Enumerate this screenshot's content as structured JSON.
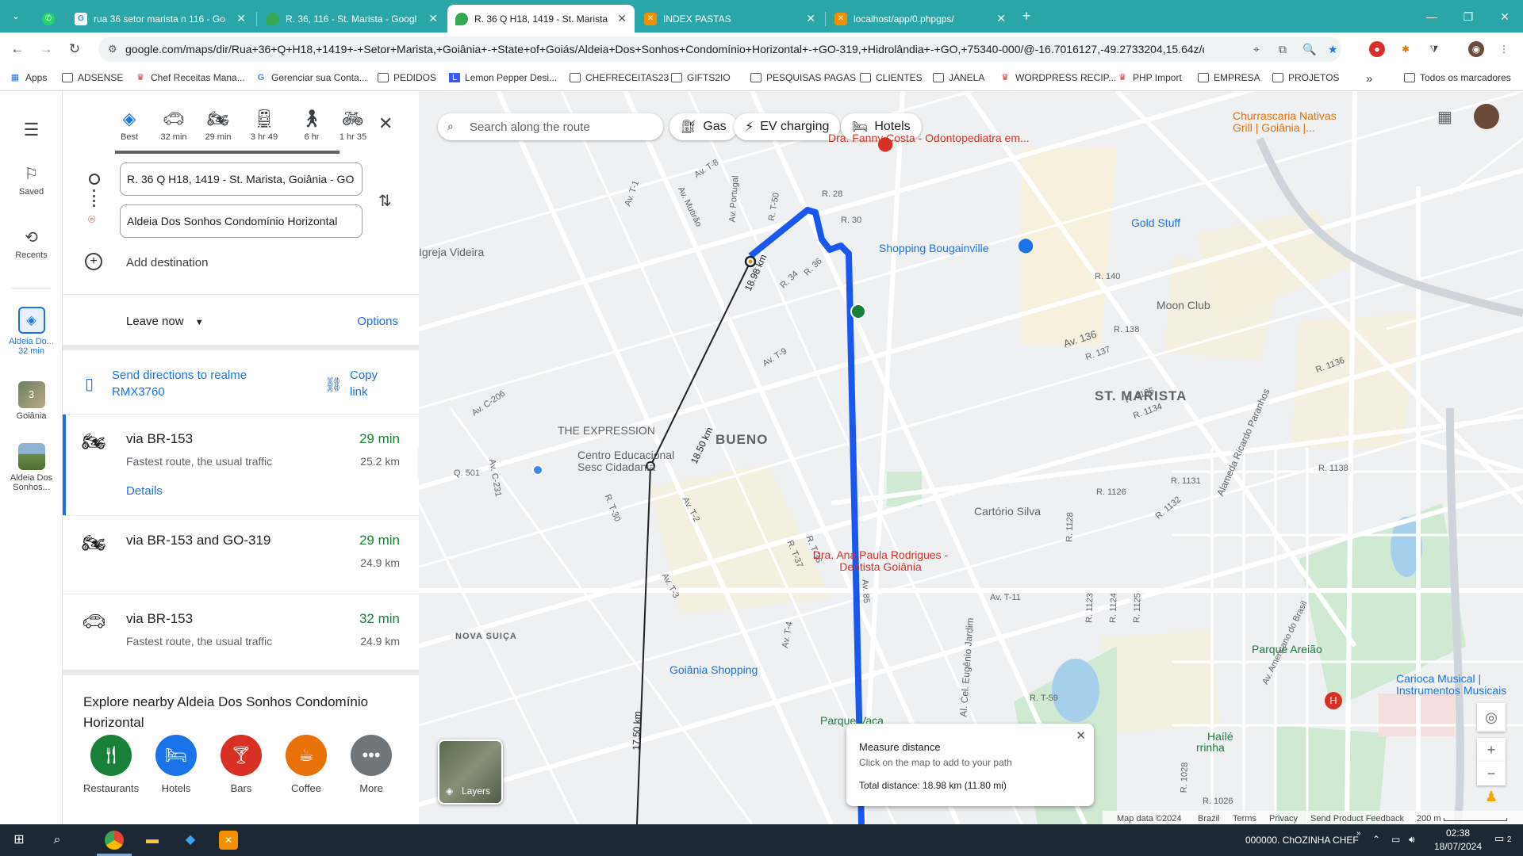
{
  "browser": {
    "tabs": [
      {
        "title": "rua 36 setor marista n 116 - Go",
        "favicon_color": "#4285f4"
      },
      {
        "title": "R. 36, 116 - St. Marista - Googl",
        "favicon_color": "#34a853"
      },
      {
        "title": "R. 36 Q H18, 1419 - St. Marista",
        "favicon_color": "#34a853"
      },
      {
        "title": "INDEX PASTAS",
        "favicon_color": "#f29100"
      },
      {
        "title": "localhost/app/0.phpgps/",
        "favicon_color": "#f29100"
      }
    ],
    "url": "google.com/maps/dir/Rua+36+Q+H18,+1419+-+Setor+Marista,+Goiânia+-+State+of+Goiás/Aldeia+Dos+Sonhos+Condomínio+Horizontal+-+GO-319,+Hidrolândia+-+GO,+75340-000/@-16.7016127,-49.2733204,15.64z/data..."
  },
  "bookmarks": [
    "Apps",
    "ADSENSE",
    "Chef Receitas Mana...",
    "Gerenciar sua Conta...",
    "PEDIDOS",
    "Lemon Pepper Desi...",
    "CHEFRECEITAS23",
    "GIFTS2IO",
    "PESQUISAS PAGAS",
    "CLIENTES",
    "JANELA",
    "WORDPRESS RECIP...",
    "PHP Import",
    "EMPRESA",
    "PROJETOS"
  ],
  "bookmarks_right": "Todos os marcadores",
  "rail": {
    "saved": "Saved",
    "recents": "Recents",
    "recent1": "Aldeia Do...",
    "recent1_sub": "32 min",
    "recent2": "Goiânia",
    "recent2_badge": "3",
    "recent3": "Aldeia Dos Sonhos..."
  },
  "modes": [
    {
      "label": "Best"
    },
    {
      "label": "32 min"
    },
    {
      "label": "29 min"
    },
    {
      "label": "3 hr 49"
    },
    {
      "label": "6 hr"
    },
    {
      "label": "1 hr 35"
    }
  ],
  "origin": "R. 36 Q H18, 1419 - St. Marista, Goiânia - GO",
  "destination": "Aldeia Dos Sonhos Condomínio Horizontal",
  "add_destination": "Add destination",
  "leave_now": "Leave now",
  "options": "Options",
  "send_directions": "Send directions to realme RMX3760",
  "copy_link": "Copy link",
  "routes": [
    {
      "via": "via BR-153",
      "desc": "Fastest route, the usual traffic",
      "time": "29 min",
      "dist": "25.2 km",
      "details": "Details"
    },
    {
      "via": "via BR-153 and GO-319",
      "desc": "",
      "time": "29 min",
      "dist": "24.9 km"
    },
    {
      "via": "via BR-153",
      "desc": "Fastest route, the usual traffic",
      "time": "32 min",
      "dist": "24.9 km"
    }
  ],
  "explore_title": "Explore nearby Aldeia Dos Sonhos Condomínio Horizontal",
  "categories": [
    {
      "label": "Restaurants",
      "color": "#188038"
    },
    {
      "label": "Hotels",
      "color": "#1a73e8"
    },
    {
      "label": "Bars",
      "color": "#d93025"
    },
    {
      "label": "Coffee",
      "color": "#e8710a"
    },
    {
      "label": "More",
      "color": "#70757a"
    }
  ],
  "map": {
    "search_placeholder": "Search along the route",
    "chips": [
      "Gas",
      "EV charging",
      "Hotels"
    ],
    "districts": [
      "BUENO",
      "ST. MARISTA",
      "NOVA SUIÇA"
    ],
    "pois": [
      "Dra. Fanny Costa - Odontopediatra em...",
      "Shopping Bougainville",
      "Gold Stuff",
      "Moon Club",
      "Igreja Videira",
      "THE EXPRESSION",
      "Centro Educacional Sesc Cidadania",
      "Cartório Silva",
      "Dra. Ana Paula Rodrigues - Dentista Goiânia",
      "Goiânia Shopping",
      "Parque Vaca",
      "Parque Areião",
      "Carioca Musical | Instrumentos Musicais",
      "Churrascaria Nativas Grill | Goiânia |...",
      "Haílé",
      "rrinha"
    ],
    "streets": [
      "Av. T-8",
      "Av. T-9",
      "Av. T-2",
      "Av. T-3",
      "Av. T-1",
      "Av. T-11",
      "Av. T-4",
      "Av. Mutirão",
      "Av. Portugal",
      "Av. 136",
      "Av. 85",
      "Av. Americano do Brasil",
      "Alameda Ricardo Paranhos",
      "Av. C-206",
      "Av. C-231",
      "R. 36",
      "R. 28",
      "R. 30",
      "R. 34",
      "R. 140",
      "R. 137",
      "R. 138",
      "R. 1136",
      "R. 1138",
      "R. 1126",
      "R. 1128",
      "R. 1123",
      "R. 1124",
      "R. 1125",
      "Q. 501",
      "R. T-37",
      "R. T-36",
      "R. T-30",
      "R. T-50",
      "Al. Cel. Eugênio Jardim",
      "R. 1131",
      "R. 1132",
      "R. 1134",
      "R. 1135",
      "R. 1026",
      "R. 1028",
      "R. T-59"
    ],
    "distance_labels": [
      "18.98 km",
      "18.50 km",
      "17.50 km"
    ],
    "layers": "Layers",
    "measure": {
      "title": "Measure distance",
      "hint": "Click on the map to add to your path",
      "total": "Total distance: 18.98 km (11.80 mi)"
    },
    "footer": [
      "Map data ©2024",
      "Brazil",
      "Terms",
      "Privacy",
      "Send Product Feedback",
      "200 m"
    ]
  },
  "taskbar": {
    "notify": "000000. ChOZINHA CHEF",
    "time": "02:38",
    "date": "18/07/2024",
    "notifications": "2"
  },
  "colors": {
    "tabstrip": "#2aa5a8",
    "route_primary": "#1a56f0",
    "route_time": "#188038",
    "link": "#1a73e8"
  }
}
